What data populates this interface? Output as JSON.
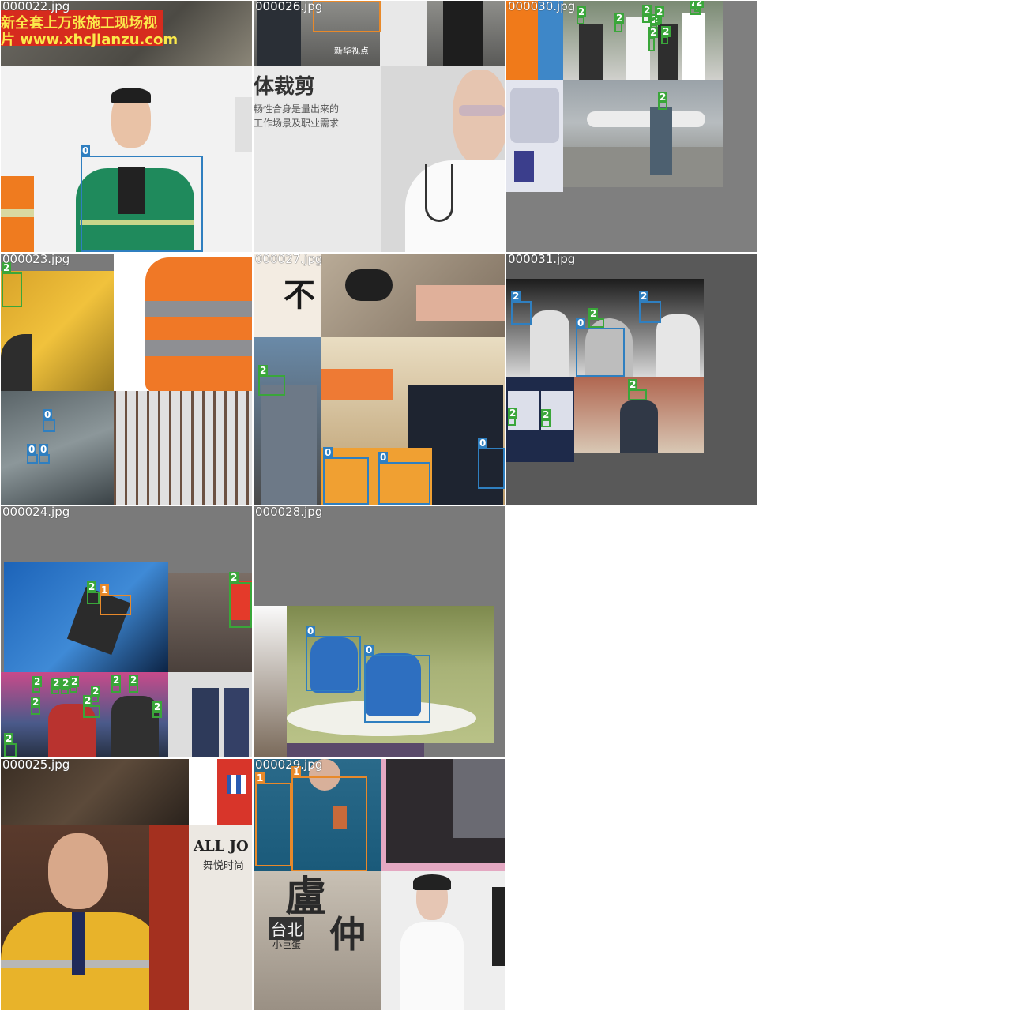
{
  "mosaic": {
    "cells": [
      {
        "file": "000022.jpg",
        "overlay_line1": "新全套上万张施工现场视",
        "overlay_line2": "片 www.xhcjianzu.com",
        "labels": [
          "0"
        ]
      },
      {
        "file": "000026.jpg",
        "watermark": "新华视点",
        "heading": "体裁剪",
        "sub1": "畅性合身是量出来的",
        "sub2": "工作场景及职业需求",
        "labels": []
      },
      {
        "file": "000030.jpg",
        "labels": [
          "2",
          "2",
          "2",
          "2",
          "2",
          "2",
          "2",
          "2",
          "2",
          "2"
        ]
      },
      {
        "file": "000023.jpg",
        "labels": [
          "2",
          "0",
          "0",
          "0"
        ]
      },
      {
        "file": "000027.jpg",
        "headline": "不",
        "labels": [
          "2",
          "0",
          "0",
          "0"
        ]
      },
      {
        "file": "000031.jpg",
        "labels": [
          "2",
          "2",
          "2",
          "0",
          "2",
          "2",
          "2"
        ]
      },
      {
        "file": "000024.jpg",
        "labels": [
          "2",
          "1",
          "2",
          "2",
          "2",
          "2",
          "2",
          "2",
          "2",
          "2",
          "2",
          "2",
          "2",
          "2"
        ]
      },
      {
        "file": "000028.jpg",
        "labels": [
          "0",
          "0"
        ]
      },
      {
        "file": "000025.jpg",
        "brand": "ALL JO",
        "brand_sub": "舞悦时尚",
        "labels": []
      },
      {
        "file": "000029.jpg",
        "cover1": "盧",
        "cover2": "仲",
        "cover3": "台北",
        "cover4": "小巨蛋",
        "labels": [
          "1",
          "1"
        ]
      }
    ]
  },
  "colors": {
    "class0": "#2f7fc0",
    "class1": "#e8892a",
    "class2": "#3aa63a",
    "background": "#ffffff",
    "tile_fill": "#7a7a7a"
  }
}
